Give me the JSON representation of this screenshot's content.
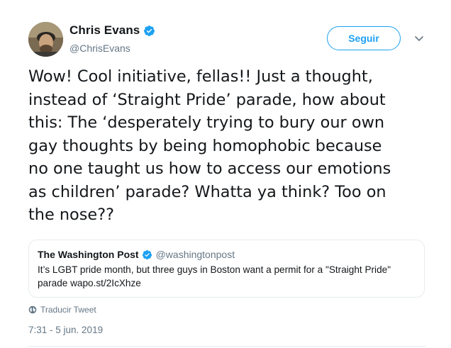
{
  "author": {
    "display_name": "Chris Evans",
    "handle": "@ChrisEvans",
    "verified_icon": "verified-badge-icon",
    "avatar_icon": "profile-photo"
  },
  "follow_button": {
    "label": "Seguir"
  },
  "menu_icon": "chevron-down-icon",
  "tweet": {
    "lines": [
      "Wow! Cool initiative, fellas!! Just a thought,",
      "instead of ‘Straight Pride’ parade, how about",
      "this: The ‘desperately trying to bury our own",
      "gay thoughts by being homophobic because",
      "no one taught us how to access our emotions",
      "as children’ parade? Whatta ya think? Too on",
      "the nose??"
    ]
  },
  "quoted_tweet": {
    "display_name": "The Washington Post",
    "handle": "@washingtonpost",
    "text_lines": [
      "It’s LGBT pride month, but three guys in Boston want a permit for a \"Straight Pride\"",
      "parade wapo.st/2IcXhze"
    ]
  },
  "translate": {
    "label": "Traducir Tweet",
    "icon": "globe-icon"
  },
  "timestamp": "7:31 - 5 jun. 2019",
  "colors": {
    "accent": "#1da1f2",
    "text": "#14171a",
    "secondary_text": "#657786",
    "border": "#e6ecf0"
  }
}
